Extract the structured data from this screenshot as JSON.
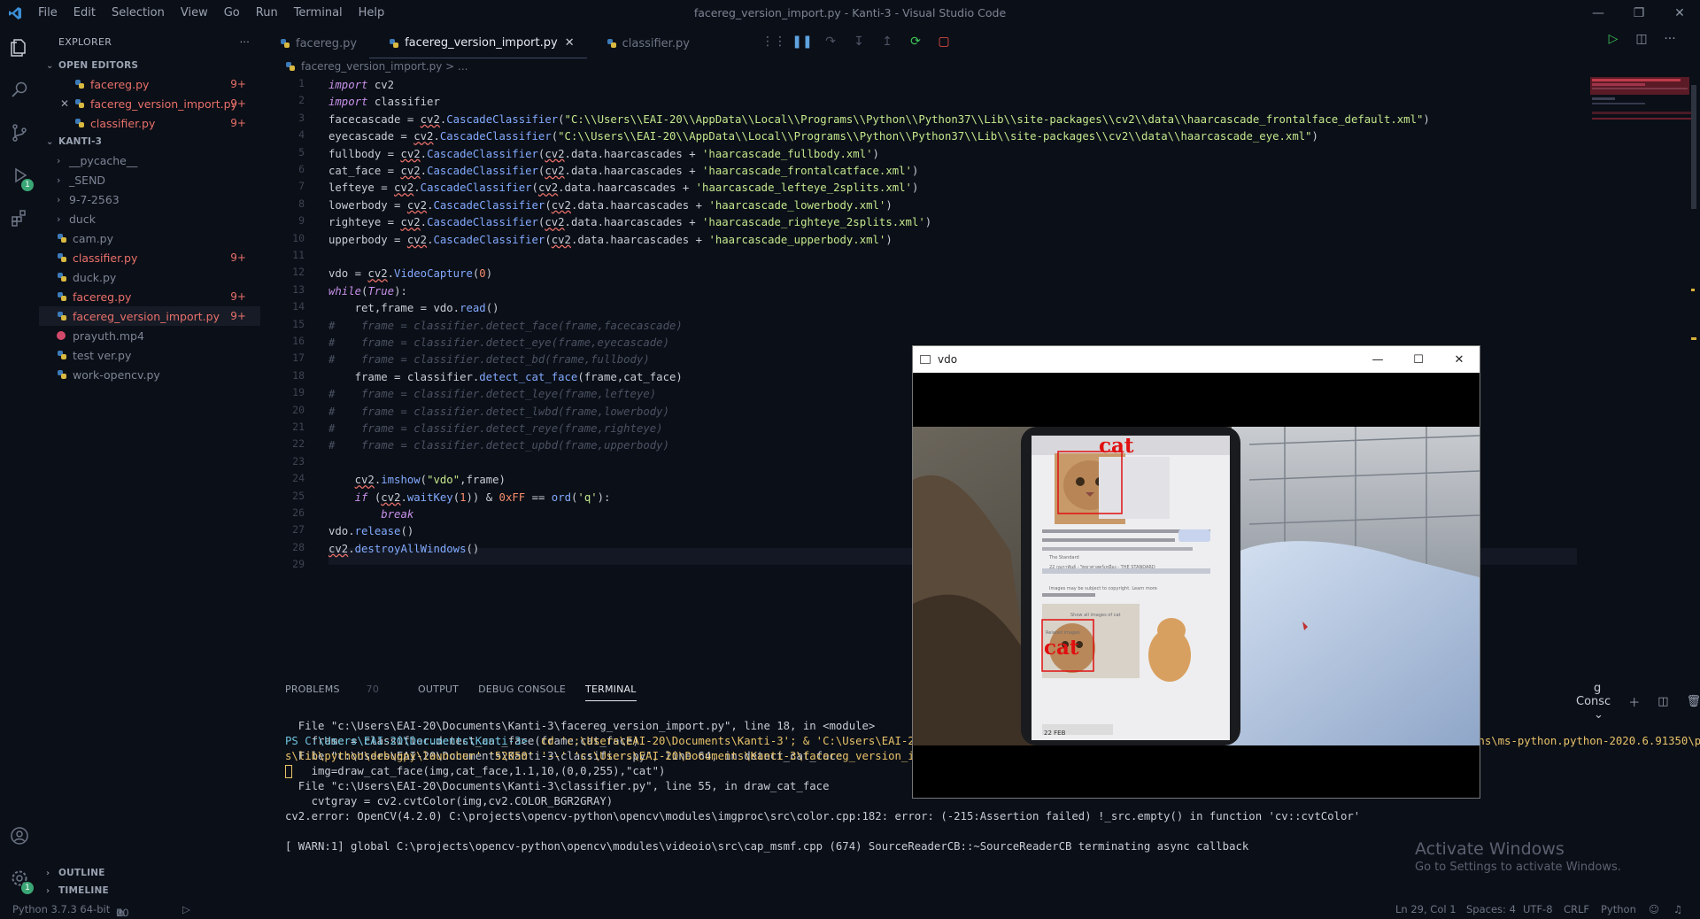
{
  "titlebar": {
    "menu": [
      "File",
      "Edit",
      "Selection",
      "View",
      "Go",
      "Run",
      "Terminal",
      "Help"
    ],
    "title": "facereg_version_import.py - Kanti-3 - Visual Studio Code"
  },
  "activity": {
    "debug_badge": "1"
  },
  "sidebar": {
    "header": "EXPLORER",
    "open_editors_label": "OPEN EDITORS",
    "open_editors": [
      {
        "name": "facereg.py",
        "badge": "9+"
      },
      {
        "name": "facereg_version_import.py",
        "badge": "9+"
      },
      {
        "name": "classifier.py",
        "badge": "9+"
      }
    ],
    "workspace_label": "KANTI-3",
    "folders": [
      "__pycache__",
      "_SEND",
      "9-7-2563",
      "duck"
    ],
    "files": [
      {
        "name": "cam.py",
        "badge": ""
      },
      {
        "name": "classifier.py",
        "badge": "9+"
      },
      {
        "name": "duck.py",
        "badge": ""
      },
      {
        "name": "facereg.py",
        "badge": "9+"
      },
      {
        "name": "facereg_version_import.py",
        "badge": "9+"
      },
      {
        "name": "prayuth.mp4",
        "badge": ""
      },
      {
        "name": "test ver.py",
        "badge": ""
      },
      {
        "name": "work-opencv.py",
        "badge": ""
      }
    ],
    "outline_label": "OUTLINE",
    "timeline_label": "TIMELINE"
  },
  "tabs": [
    {
      "label": "facereg.py"
    },
    {
      "label": "facereg_version_import.py"
    },
    {
      "label": "classifier.py"
    }
  ],
  "breadcrumb": "facereg_version_import.py > ...",
  "code_lines": [
    "import cv2",
    "import classifier",
    "facecascade = cv2.CascadeClassifier(\"C:\\\\Users\\\\EAI-20\\\\AppData\\\\Local\\\\Programs\\\\Python\\\\Python37\\\\Lib\\\\site-packages\\\\cv2\\\\data\\\\haarcascade_frontalface_default.xml\")",
    "eyecascade = cv2.CascadeClassifier(\"C:\\\\Users\\\\EAI-20\\\\AppData\\\\Local\\\\Programs\\\\Python\\\\Python37\\\\Lib\\\\site-packages\\\\cv2\\\\data\\\\haarcascade_eye.xml\")",
    "fullbody = cv2.CascadeClassifier(cv2.data.haarcascades + 'haarcascade_fullbody.xml')",
    "cat_face = cv2.CascadeClassifier(cv2.data.haarcascades + 'haarcascade_frontalcatface.xml')",
    "lefteye = cv2.CascadeClassifier(cv2.data.haarcascades + 'haarcascade_lefteye_2splits.xml')",
    "lowerbody = cv2.CascadeClassifier(cv2.data.haarcascades + 'haarcascade_lowerbody.xml')",
    "righteye = cv2.CascadeClassifier(cv2.data.haarcascades + 'haarcascade_righteye_2splits.xml')",
    "upperbody = cv2.CascadeClassifier(cv2.data.haarcascades + 'haarcascade_upperbody.xml')",
    "",
    "vdo = cv2.VideoCapture(0)",
    "while(True):",
    "    ret,frame = vdo.read()",
    "#    frame = classifier.detect_face(frame,facecascade)",
    "#    frame = classifier.detect_eye(frame,eyecascade)",
    "#    frame = classifier.detect_bd(frame,fullbody)",
    "    frame = classifier.detect_cat_face(frame,cat_face)",
    "#    frame = classifier.detect_leye(frame,lefteye)",
    "#    frame = classifier.detect_lwbd(frame,lowerbody)",
    "#    frame = classifier.detect_reye(frame,righteye)",
    "#    frame = classifier.detect_upbd(frame,upperbody)",
    "",
    "    cv2.imshow(\"vdo\",frame)",
    "    if (cv2.waitKey(1)) & 0xFF == ord('q'):",
    "        break",
    "vdo.release()",
    "cv2.destroyAllWindows()",
    ""
  ],
  "panel": {
    "tabs": [
      "PROBLEMS",
      "OUTPUT",
      "DEBUG CONSOLE",
      "TERMINAL"
    ],
    "problems_count": "70",
    "dropdown": "g Consc"
  },
  "terminal_lines": [
    "  File \"c:\\Users\\EAI-20\\Documents\\Kanti-3\\facereg_version_import.py\", line 18, in <module>",
    "    frame = classifier.detect_cat_face(frame,cat_face)",
    "  File \"c:\\Users\\EAI-20\\Documents\\Kanti-3\\classifier.py\", line 64, in detect_cat_face",
    "    img=draw_cat_face(img,cat_face,1.1,10,(0,0,255),\"cat\")",
    "  File \"c:\\Users\\EAI-20\\Documents\\Kanti-3\\classifier.py\", line 55, in draw_cat_face",
    "    cvtgray = cv2.cvtColor(img,cv2.COLOR_BGR2GRAY)",
    "cv2.error: OpenCV(4.2.0) C:\\projects\\opencv-python\\opencv\\modules\\imgproc\\src\\color.cpp:182: error: (-215:Assertion failed) !_src.empty() in function 'cv::cvtColor'",
    "",
    "[ WARN:1] global C:\\projects\\opencv-python\\opencv\\modules\\videoio\\src\\cap_msmf.cpp (674) SourceReaderCB::~SourceReaderCB terminating async callback"
  ],
  "terminal_prompt": {
    "path": "PS C:\\Users\\EAI-20\\Documents\\Kanti-3>",
    "command": "  cd 'c:\\Users\\EAI-20\\Documents\\Kanti-3'; & 'C:\\Users\\EAI-20\\AppData\\Local\\Programs\\Python\\Python37\\python.exe' 'c:\\Users\\EAI-20\\.vscode\\extensions\\ms-python.python-2020.6.91350\\pythonFile",
    "command2": "s\\lib\\python\\debugpy\\launcher' '52050' '--' 'c:\\Users\\EAI-20\\Documents\\Kanti-3\\facereg_version_import.py'"
  },
  "watermark": {
    "line1": "Activate Windows",
    "line2": "Go to Settings to activate Windows."
  },
  "statusbar": {
    "python": "Python 3.7.3 64-bit",
    "errors": "70",
    "warnings": "0",
    "position": "Ln 29, Col 1",
    "spaces": "Spaces: 4",
    "encoding": "UTF-8",
    "eol": "CRLF",
    "language": "Python"
  },
  "vdo_window": {
    "title": "vdo",
    "labels": [
      "cat",
      "cat"
    ],
    "phone_text": [
      "The Standard",
      "22 กุมภาพันธ์ - วิทยาศาสตร์เหมือง - THE STANDARD",
      "Images may be subject to copyright. Learn more",
      "Show all images of cat",
      "Related images",
      "22 FEB"
    ]
  },
  "colors": {
    "background": "#0b0f17",
    "error": "#e8706a",
    "keyword": "#c792ea",
    "string": "#c3e88d",
    "function": "#82aaff",
    "detect_box": "#e01010"
  }
}
